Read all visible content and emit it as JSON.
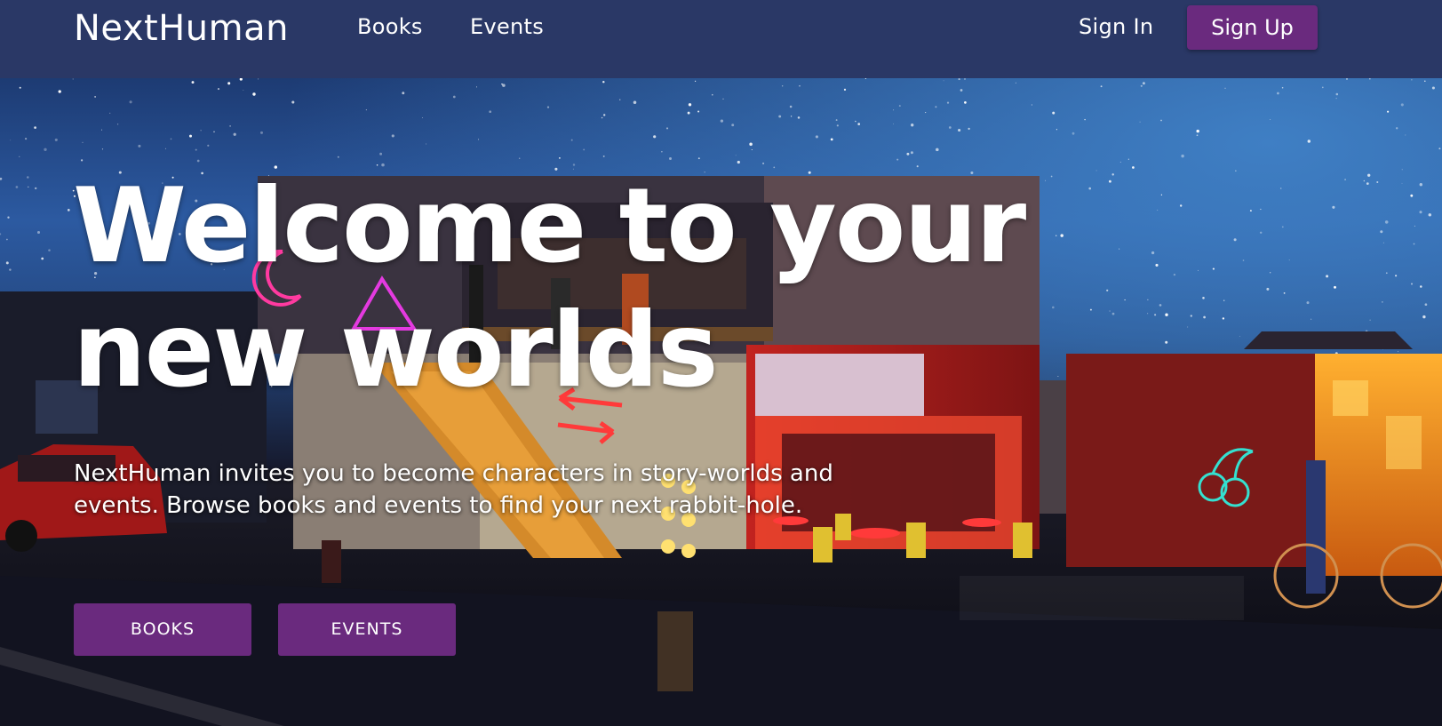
{
  "nav": {
    "brand": "NextHuman",
    "links": [
      {
        "label": "Books"
      },
      {
        "label": "Events"
      }
    ],
    "sign_in": "Sign In",
    "sign_up": "Sign Up"
  },
  "hero": {
    "title": "Welcome to your new worlds",
    "description": "NextHuman invites you to become characters in story-worlds and events. Browse books and events to find your next rabbit-hole.",
    "buttons": [
      {
        "label": "BOOKS"
      },
      {
        "label": "EVENTS"
      }
    ]
  },
  "colors": {
    "navbar_bg": "#2a3866",
    "accent_purple": "#6a2a7e"
  }
}
